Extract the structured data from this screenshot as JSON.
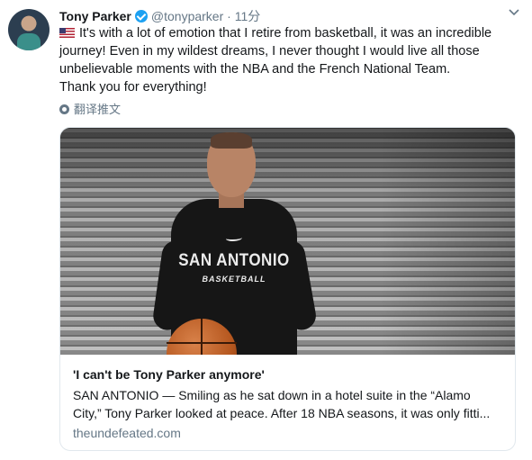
{
  "tweet": {
    "author_name": "Tony Parker",
    "handle": "@tonyparker",
    "separator": "·",
    "time": "11分",
    "verified_icon": "verified-badge-icon",
    "text_lines": [
      "It's with a lot of emotion that I retire from basketball, it was an incredible",
      "journey! Even in my wildest dreams, I never thought I would live all those",
      "unbelievable moments with the NBA and the French National Team.",
      "Thank you for everything!"
    ],
    "flag_icon": "us-flag-emoji",
    "translate_label": "翻译推文"
  },
  "card": {
    "title": "'I can't be Tony Parker anymore'",
    "description_lines": [
      "SAN ANTONIO — Smiling as he sat down in a hotel suite in the “Alamo",
      "City,” Tony Parker looked at peace. After 18 NBA seasons, it was only fitti..."
    ],
    "domain": "theundefeated.com",
    "image_text": {
      "line1": "SAN ANTONIO",
      "line2": "BASKETBALL"
    }
  },
  "colors": {
    "accent": "#1da1f2",
    "text": "#14171a",
    "muted": "#657786",
    "border": "#e1e8ed"
  }
}
